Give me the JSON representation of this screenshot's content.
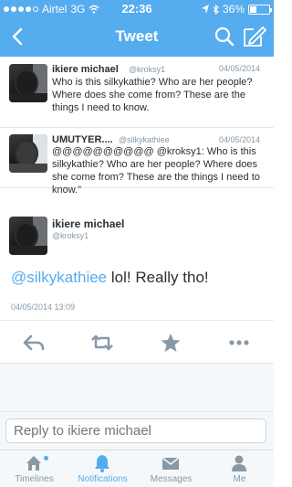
{
  "status": {
    "carrier": "Airtel",
    "network": "3G",
    "time": "22:36",
    "battery": "36%",
    "battery_level": 0.36
  },
  "header": {
    "title": "Tweet"
  },
  "tweets": [
    {
      "name": "ikiere michael",
      "handle": "@kroksy1",
      "date": "04/05/2014",
      "text": "Who is this silkykathie? Who are her people? Where does she come from? These are the things I need to know."
    },
    {
      "name": "UMUTYER....",
      "handle": "@silkykathiee",
      "date": "04/05/2014",
      "text": "@@@@@@@@@@  @kroksy1: Who is this silkykathie? Who are her people? Where does she come from? These are the things I need to know.\""
    }
  ],
  "focus": {
    "name": "ikiere michael",
    "handle": "@kroksy1",
    "mention": "@silkykathiee",
    "text": " lol! Really tho!",
    "timestamp": "04/05/2014 13:09"
  },
  "reply": {
    "placeholder": "Reply to ikiere michael"
  },
  "tabs": [
    {
      "label": "Timelines",
      "icon": "home-icon"
    },
    {
      "label": "Notifications",
      "icon": "bell-icon"
    },
    {
      "label": "Messages",
      "icon": "envelope-icon"
    },
    {
      "label": "Me",
      "icon": "person-icon"
    }
  ],
  "colors": {
    "brand": "#55acee",
    "text": "#292f33",
    "muted": "#8899a6",
    "action": "#8899a6"
  }
}
